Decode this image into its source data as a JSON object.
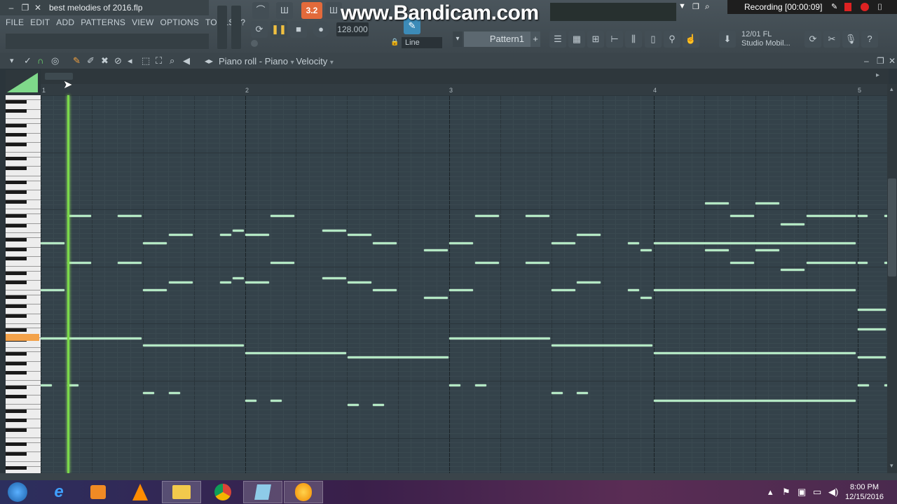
{
  "window": {
    "filename": "best melodies of 2016.flp"
  },
  "menu": [
    "FILE",
    "EDIT",
    "ADD",
    "PATTERNS",
    "VIEW",
    "OPTIONS",
    "TOOLS",
    "?"
  ],
  "transport": {
    "tempo": "128.000",
    "time_sig": "3.2",
    "snap": "Line",
    "pattern": "Pattern1"
  },
  "news": {
    "line1": "12/01  FL",
    "line2": "Studio Mobil..."
  },
  "overlay": {
    "watermark": "www.Bandicam.com",
    "recording": "Recording [00:00:09]"
  },
  "pianoroll": {
    "title": "Piano roll - Piano",
    "target": "Velocity",
    "bars": [
      "1",
      "2",
      "3",
      "4",
      "5"
    ]
  },
  "taskbar": {
    "time": "8:00 PM",
    "date": "12/15/2016"
  },
  "colors": {
    "note": "#b4e8c4",
    "playhead": "#7bd94b",
    "grid_bg": "#34424a",
    "active_key": "#f3a24a"
  },
  "icons": [
    "windows-start-icon",
    "internet-explorer-icon",
    "media-player-icon",
    "vlc-icon",
    "file-explorer-icon",
    "chrome-icon",
    "notepad-icon",
    "fl-studio-icon"
  ]
}
